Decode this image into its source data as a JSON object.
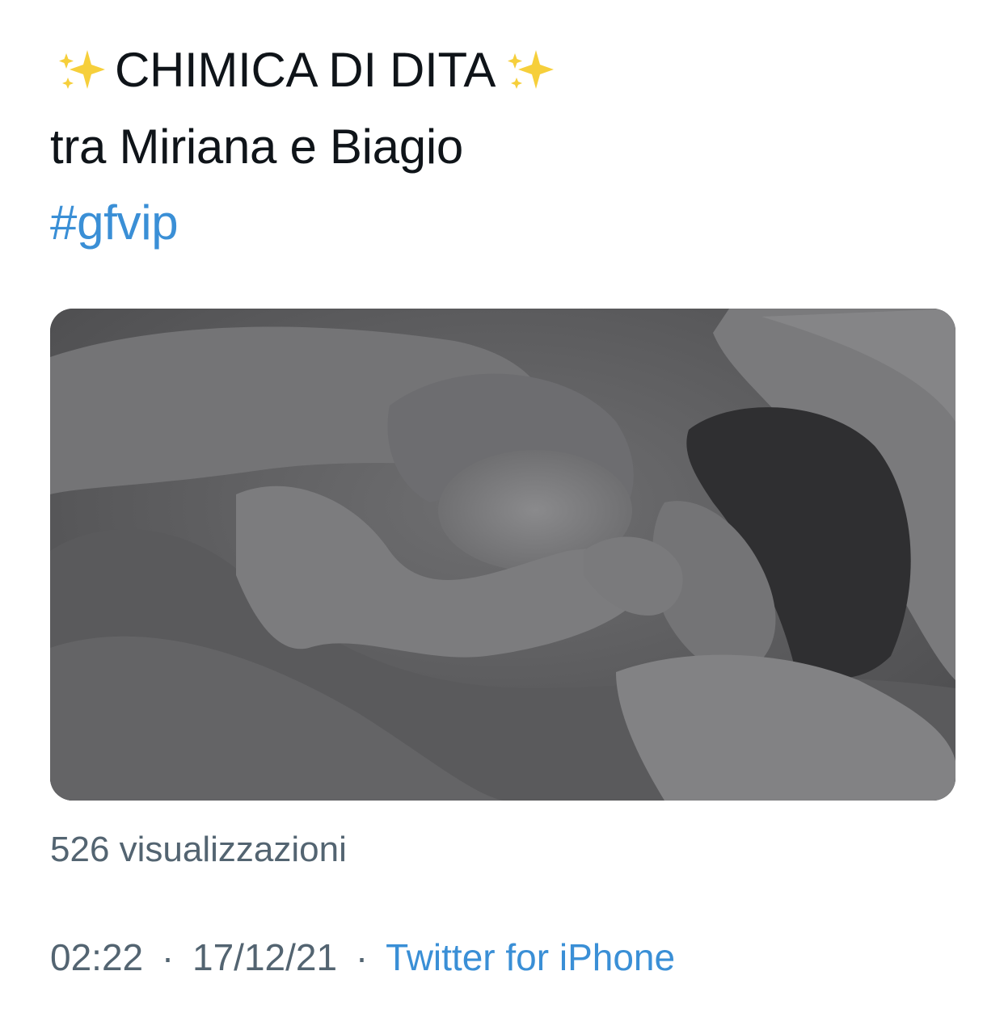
{
  "tweet": {
    "headline": "CHIMICA DI DITA",
    "subline": "tra Miriana e Biagio",
    "hashtag": "#gfvip",
    "media_icon": "sparkles-icon"
  },
  "stats": {
    "views": "526 visualizzazioni"
  },
  "meta": {
    "time": "02:22",
    "date": "17/12/21",
    "separator": "·",
    "source": "Twitter for iPhone"
  },
  "colors": {
    "text": "#0f1419",
    "secondary": "#536471",
    "link": "#3a8fd6",
    "sparkle": "#f5c518"
  }
}
